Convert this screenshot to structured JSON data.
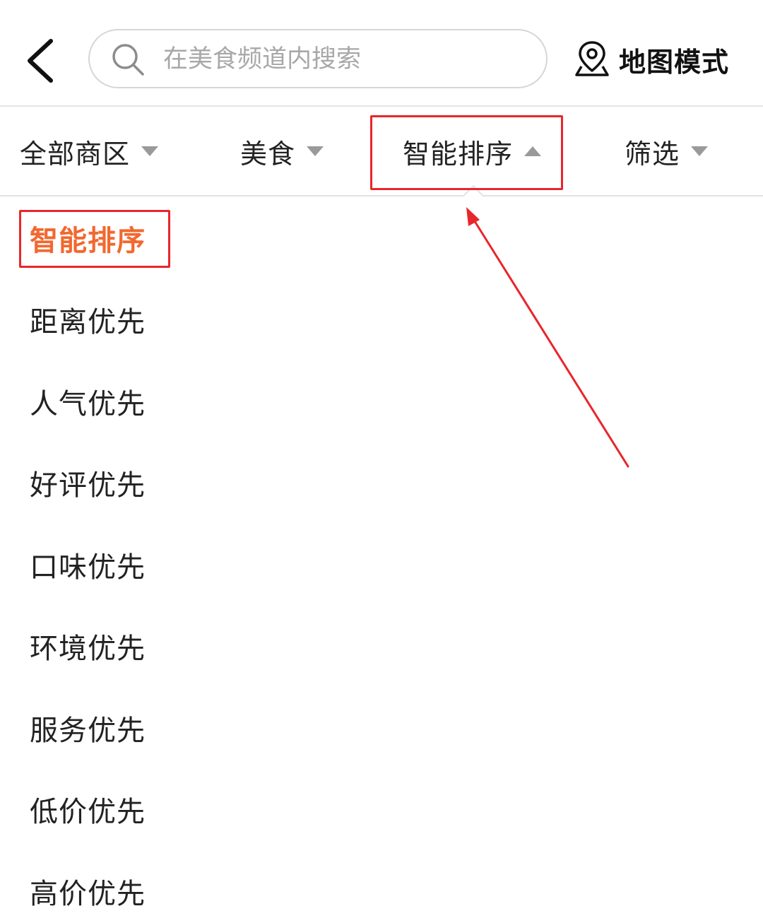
{
  "header": {
    "back_icon": "chevron-left-icon",
    "search": {
      "placeholder": "在美食频道内搜索",
      "value": "",
      "icon": "search-icon"
    },
    "map_mode": {
      "label": "地图模式",
      "icon": "map-pin-icon"
    }
  },
  "filter_tabs": [
    {
      "label": "全部商区",
      "caret": "down",
      "active": false
    },
    {
      "label": "美食",
      "caret": "down",
      "active": false
    },
    {
      "label": "智能排序",
      "caret": "up",
      "active": true
    },
    {
      "label": "筛选",
      "caret": "down",
      "active": false
    }
  ],
  "sort_options": {
    "selected_index": 0,
    "items": [
      {
        "label": "智能排序"
      },
      {
        "label": "距离优先"
      },
      {
        "label": "人气优先"
      },
      {
        "label": "好评优先"
      },
      {
        "label": "口味优先"
      },
      {
        "label": "环境优先"
      },
      {
        "label": "服务优先"
      },
      {
        "label": "低价优先"
      },
      {
        "label": "高价优先"
      }
    ]
  },
  "colors": {
    "selected_text": "#f2682f",
    "annotation_red": "#e8262b",
    "caret_gray": "#9a9a9a",
    "placeholder_gray": "#a8a8a8"
  }
}
